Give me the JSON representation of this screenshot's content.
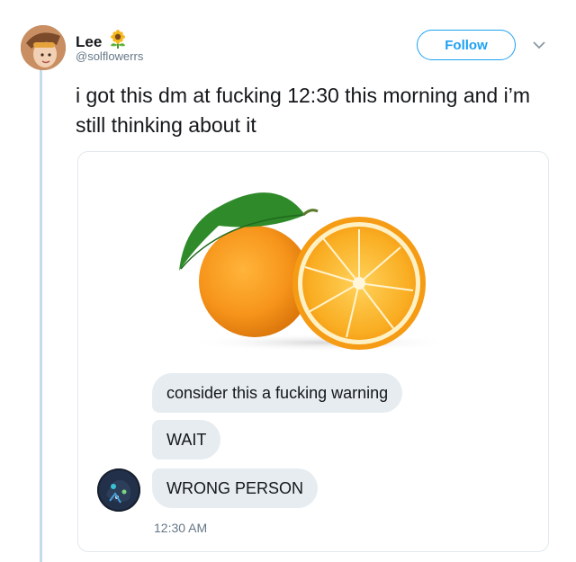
{
  "author": {
    "display_name": "Lee",
    "name_emoji": "sunflower-icon",
    "handle": "@solflowerrs"
  },
  "actions": {
    "follow_label": "Follow",
    "more_icon": "chevron-down-icon"
  },
  "tweet": {
    "text": "i got this dm at fucking 12:30 this morning and i’m still thinking about it"
  },
  "media": {
    "image_icon": "oranges-image",
    "messages": [
      {
        "text": "consider this a fucking warning"
      },
      {
        "text": "WAIT"
      },
      {
        "text": "WRONG PERSON"
      }
    ],
    "timestamp": "12:30 AM"
  },
  "colors": {
    "accent": "#1da1f2",
    "bubble": "#e6ecf0",
    "thread_line": "#c4dbe9",
    "secondary_text": "#657786"
  }
}
